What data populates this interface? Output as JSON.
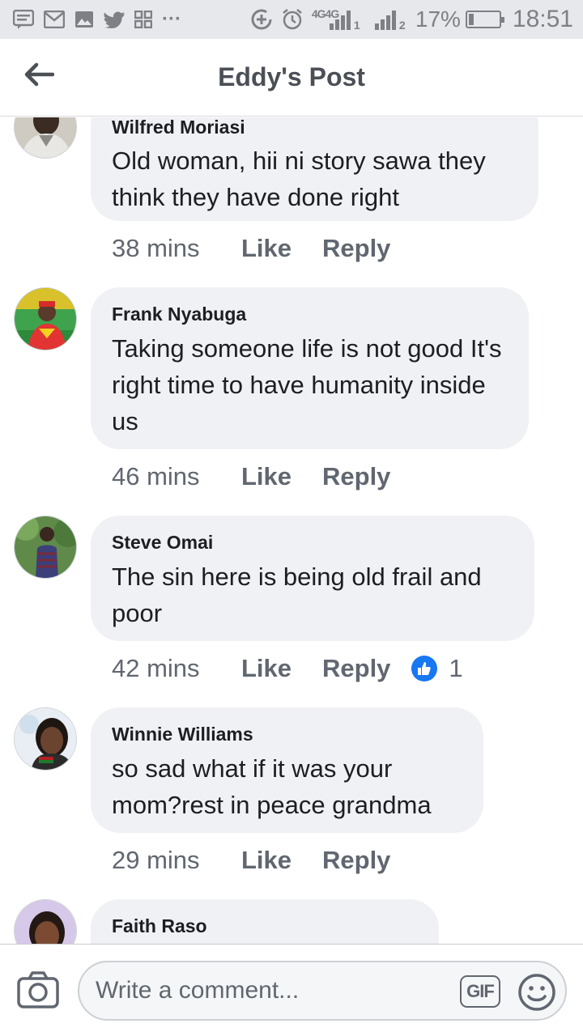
{
  "status_bar": {
    "battery_percent": "17%",
    "battery_level": 0.17,
    "time": "18:51",
    "network_label": "4G4G",
    "sim1": "1",
    "sim2": "2",
    "more": "···",
    "left_icons": [
      "message-icon",
      "gmail-icon",
      "gallery-icon",
      "twitter-icon",
      "app-icon"
    ],
    "right_icons": [
      "data-saver-icon",
      "alarm-icon",
      "signal-icon",
      "signal-icon",
      "battery-icon"
    ]
  },
  "header": {
    "back_icon": "arrow-left-icon",
    "title": "Eddy's Post"
  },
  "comments": [
    {
      "author": "Wilfred Moriasi",
      "text": "Old woman, hii ni story sawa they think they have done right",
      "time": "38 mins",
      "like": "Like",
      "reply": "Reply"
    },
    {
      "author": "Frank Nyabuga",
      "text": "Taking someone  life is not good It's right time to have humanity inside us",
      "time": "46 mins",
      "like": "Like",
      "reply": "Reply"
    },
    {
      "author": "Steve Omai",
      "text": "The sin here is being old frail and poor",
      "time": "42 mins",
      "like": "Like",
      "reply": "Reply",
      "reaction_icon": "thumbs-up-icon",
      "reaction_count": "1"
    },
    {
      "author": "Winnie Williams",
      "text": "so sad what if it was your mom?rest in peace grandma",
      "time": "29 mins",
      "like": "Like",
      "reply": "Reply"
    },
    {
      "author": "Faith Raso",
      "text": "",
      "time": "",
      "like": "",
      "reply": ""
    }
  ],
  "composer": {
    "camera_icon": "camera-icon",
    "placeholder": "Write a comment...",
    "gif_label": "GIF",
    "emoji_icon": "smiley-icon"
  },
  "colors": {
    "accent": "#1877f2",
    "bubble": "#f0f1f4",
    "muted_text": "#606770",
    "status_bar": "#e6e8ec",
    "title": "#4b4f56"
  }
}
